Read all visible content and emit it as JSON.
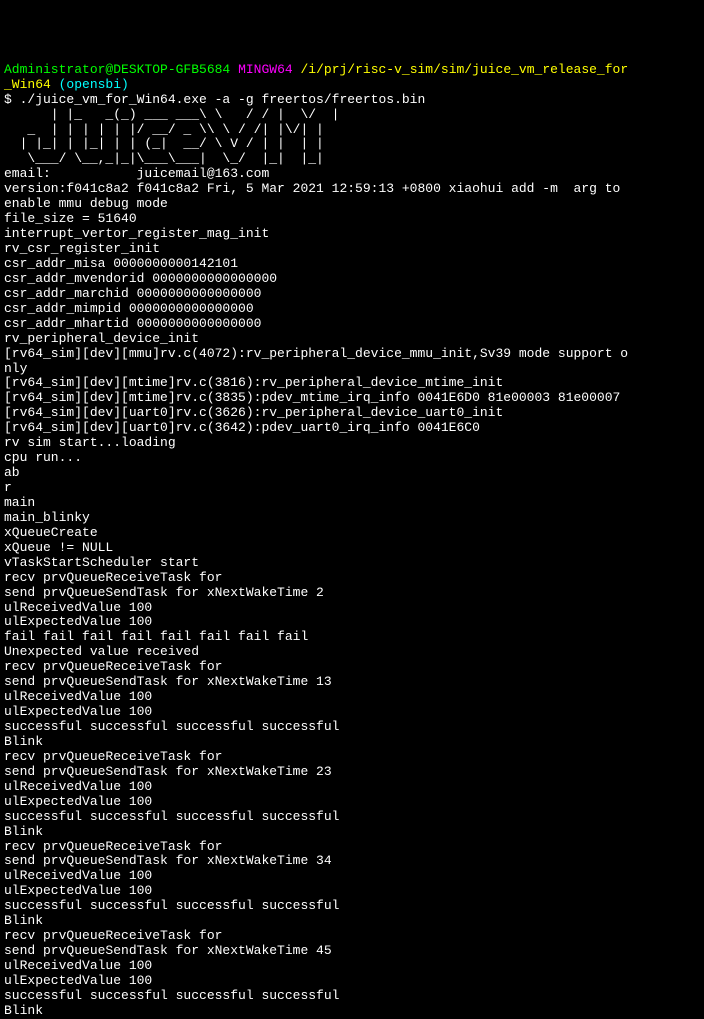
{
  "prompt": {
    "user": "Administrator@DESKTOP-GFB5684",
    "host": "MINGW64",
    "path": "/i/prj/risc-v_sim/sim/juice_vm_release_for",
    "path2": "_Win64",
    "branch": "(opensbi)"
  },
  "command": "$ ./juice_vm_for_Win64.exe -a -g freertos/freertos.bin",
  "ascii_art": {
    "l1": "      | |_   _(_) ___ ___\\ \\   / / |  \\/  |",
    "l2": "   _  | | | | | |/ __/ _ \\\\ \\ / /| |\\/| |",
    "l3": "  | |_| | |_| | | (_|  __/ \\ V / | |  | |",
    "l4": "   \\___/ \\__,_|_|\\___\\___|  \\_/  |_|  |_|"
  },
  "lines": {
    "email": "email:           juicemail@163.com",
    "version": "version:f041c8a2 f041c8a2 Fri, 5 Mar 2021 12:59:13 +0800 xiaohui add -m  arg to",
    "version2": "enable mmu debug mode",
    "filesize": "file_size = 51640",
    "ivr": "interrupt_vertor_register_mag_init",
    "csr_init": "rv_csr_register_init",
    "csr1": "csr_addr_misa 0000000000142101",
    "csr2": "csr_addr_mvendorid 0000000000000000",
    "csr3": "csr_addr_marchid 0000000000000000",
    "csr4": "csr_addr_mimpid 0000000000000000",
    "csr5": "csr_addr_mhartid 0000000000000000",
    "periph_init": "rv_peripheral_device_init",
    "mmu1": "[rv64_sim][dev][mmu]rv.c(4072):rv_peripheral_device_mmu_init,Sv39 mode support o",
    "mmu2": "nly",
    "mtime1": "[rv64_sim][dev][mtime]rv.c(3816):rv_peripheral_device_mtime_init",
    "mtime2": "[rv64_sim][dev][mtime]rv.c(3835):pdev_mtime_irq_info 0041E6D0 81e00003 81e00007",
    "uart1": "[rv64_sim][dev][uart0]rv.c(3626):rv_peripheral_device_uart0_init",
    "uart2": "[rv64_sim][dev][uart0]rv.c(3642):pdev_uart0_irq_info 0041E6C0",
    "start": "rv sim start...loading",
    "cpurun": "cpu run...",
    "ab": "ab",
    "r": "r",
    "main": "main",
    "blinky": "main_blinky",
    "xqc": "xQueueCreate",
    "xqn": "xQueue != NULL",
    "vtask": "vTaskStartScheduler start",
    "recv1": "recv prvQueueReceiveTask for",
    "send1": "send prvQueueSendTask for xNextWakeTime 2",
    "ulrecv": "ulReceivedValue 100",
    "ulexp": "ulExpectedValue 100",
    "fail": "fail fail fail fail fail fail fail fail",
    "unexp": "Unexpected value received",
    "recv2": "recv prvQueueReceiveTask for",
    "send2": "send prvQueueSendTask for xNextWakeTime 13",
    "success": "successful successful successful successful",
    "blink": "Blink",
    "send3": "send prvQueueSendTask for xNextWakeTime 23",
    "send4": "send prvQueueSendTask for xNextWakeTime 34",
    "send5": "send prvQueueSendTask for xNextWakeTime 45"
  }
}
